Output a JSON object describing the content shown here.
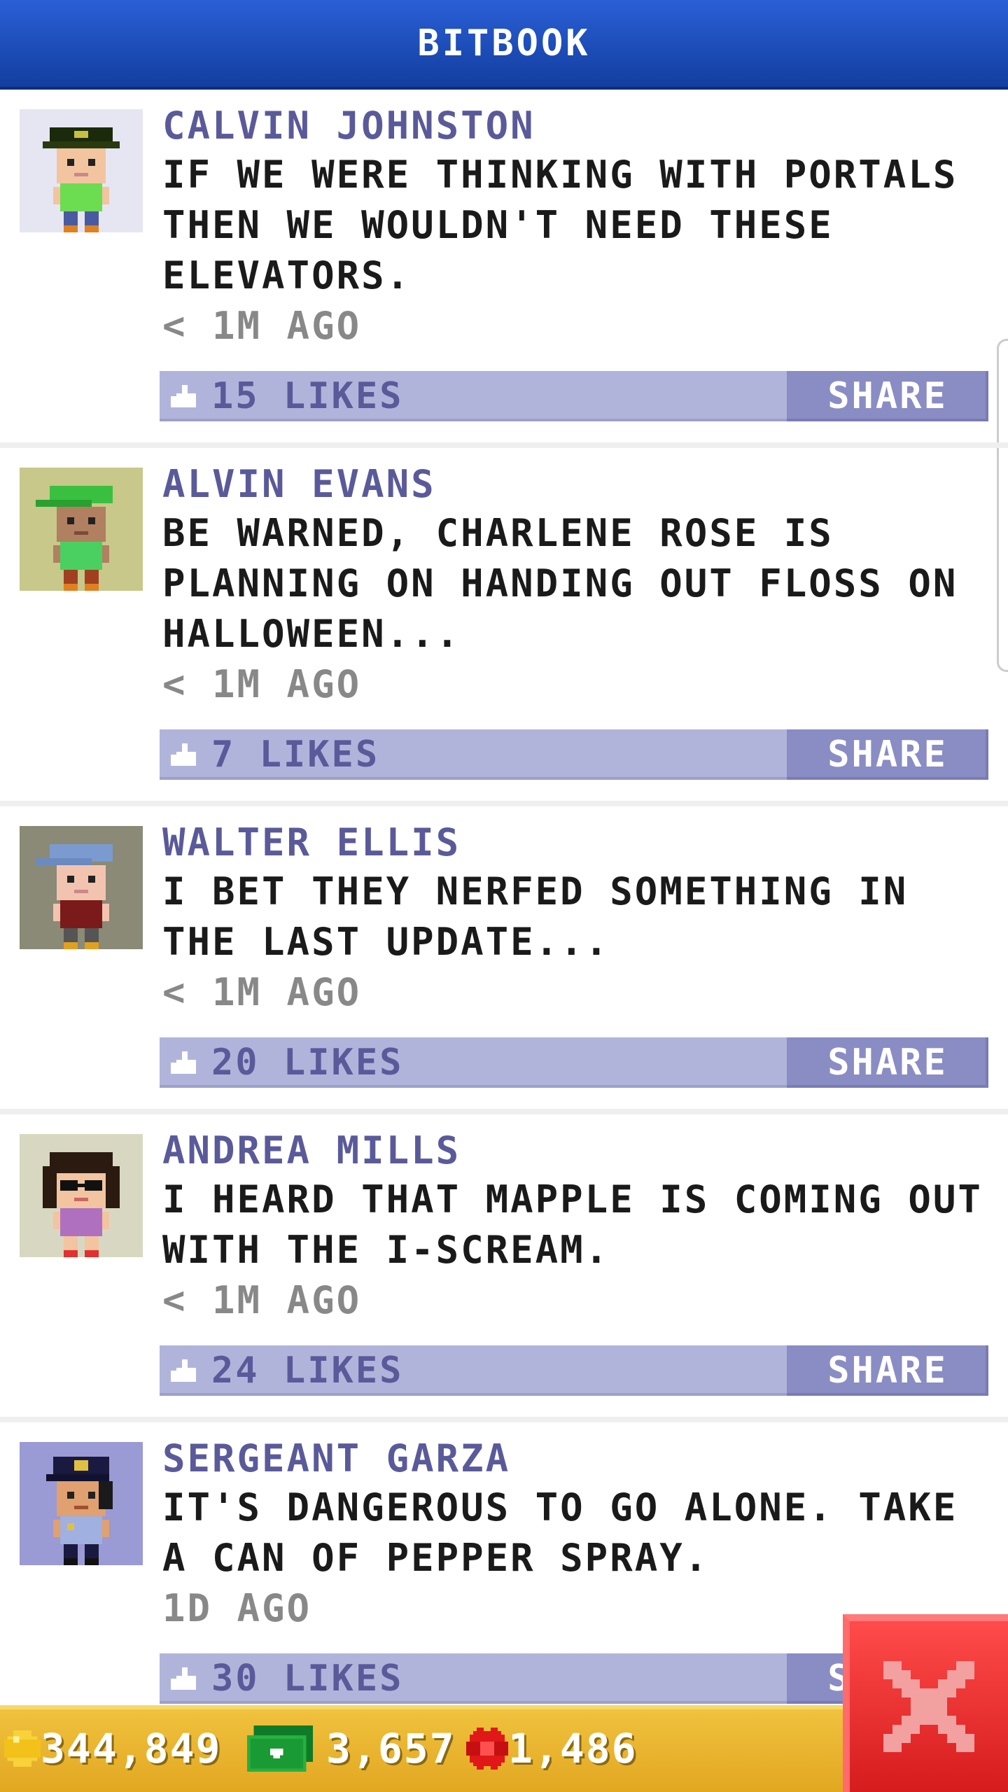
{
  "header": {
    "title": "BITBOOK"
  },
  "posts": [
    {
      "name": "CALVIN JOHNSTON",
      "message": "IF WE WERE THINKING WITH PORTALS THEN WE WOULDN'T NEED THESE ELEVATORS.",
      "time": "< 1M AGO",
      "likes": "15 LIKES",
      "share": "SHARE",
      "avatar_bg": "#e6e6f2"
    },
    {
      "name": "ALVIN EVANS",
      "message": "BE WARNED, CHARLENE ROSE IS PLANNING ON HANDING OUT FLOSS ON HALLOWEEN...",
      "time": "< 1M AGO",
      "likes": "7 LIKES",
      "share": "SHARE",
      "avatar_bg": "#c8c88a"
    },
    {
      "name": "WALTER ELLIS",
      "message": "I BET THEY NERFED SOMETHING IN THE LAST UPDATE...",
      "time": "< 1M AGO",
      "likes": "20 LIKES",
      "share": "SHARE",
      "avatar_bg": "#8a8a76"
    },
    {
      "name": "ANDREA MILLS",
      "message": "I HEARD THAT MAPPLE IS COMING OUT WITH THE I-SCREAM.",
      "time": "< 1M AGO",
      "likes": "24 LIKES",
      "share": "SHARE",
      "avatar_bg": "#d8d8c2"
    },
    {
      "name": "SERGEANT GARZA",
      "message": "IT'S DANGEROUS TO GO ALONE. TAKE A CAN OF PEPPER SPRAY.",
      "time": "1D AGO",
      "likes": "30 LIKES",
      "share": "SHARE",
      "avatar_bg": "#9a9ad4"
    }
  ],
  "currency": {
    "coins": "344,849",
    "bux": "3,657",
    "tickets": "1,486"
  },
  "icons": {
    "coin": "coin-icon",
    "bux": "bux-icon",
    "ticket": "ticket-icon",
    "close": "close-icon",
    "like": "thumbs-up-icon"
  },
  "colors": {
    "header": "#1a4cc0",
    "likes_bar": "#b1b4da",
    "share_button": "#8a8cc4",
    "name": "#5a5a9a",
    "bottom_bar": "#e8b42c",
    "close_button": "#e02a2a"
  }
}
